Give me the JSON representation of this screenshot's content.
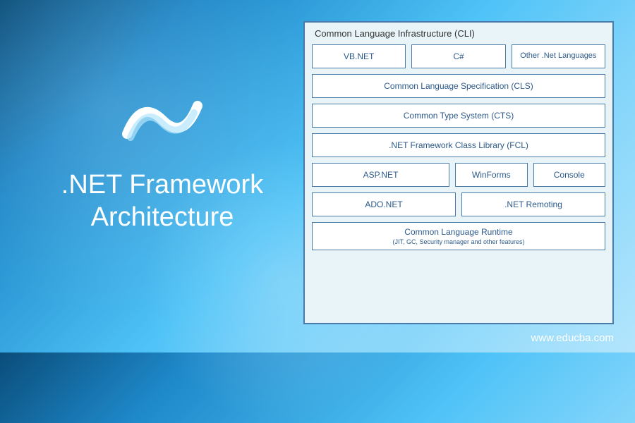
{
  "title": ".NET Framework Architecture",
  "footer_url": "www.educba.com",
  "diagram": {
    "container_title": "Common Language Infrastructure (CLI)",
    "row1": {
      "vbnet": "VB.NET",
      "csharp": "C#",
      "other": "Other .Net Languages"
    },
    "cls": "Common Language Specification (CLS)",
    "cts": "Common Type System (CTS)",
    "fcl": ".NET Framework Class Library (FCL)",
    "row5": {
      "aspnet": "ASP.NET",
      "winforms": "WinForms",
      "console": "Console"
    },
    "row6": {
      "adonet": "ADO.NET",
      "remoting": ".NET Remoting"
    },
    "clr": {
      "title": "Common Language Runtime",
      "subtitle": "(JIT, GC, Security manager and other features)"
    }
  }
}
